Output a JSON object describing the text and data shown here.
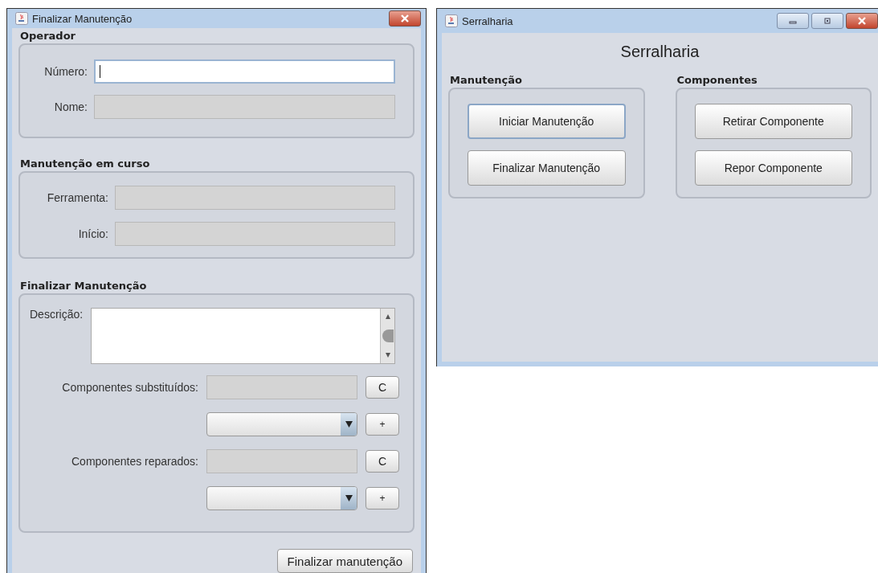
{
  "dialog": {
    "title": "Finalizar Manutenção",
    "operador": {
      "title": "Operador",
      "fields": [
        {
          "label": "Número:",
          "editable": true,
          "focused": true
        },
        {
          "label": "Nome:",
          "editable": false,
          "focused": false
        }
      ]
    },
    "em_curso": {
      "title": "Manutenção em curso",
      "fields": [
        {
          "label": "Ferramenta:",
          "editable": false,
          "focused": false
        },
        {
          "label": "Início:",
          "editable": false,
          "focused": false
        }
      ]
    },
    "finalizar": {
      "title": "Finalizar Manutenção",
      "description_label": "Descrição:",
      "components": [
        {
          "label": "Componentes substituídos:",
          "clear_button": "C",
          "add_button": "+"
        },
        {
          "label": "Componentes reparados:",
          "clear_button": "C",
          "add_button": "+"
        }
      ]
    },
    "submit_button": "Finalizar manutenção"
  },
  "main_window": {
    "title": "Serralharia",
    "heading": "Serralharia",
    "groups": [
      {
        "title": "Manutenção",
        "buttons": [
          {
            "label": "Iniciar Manutenção",
            "focused": true
          },
          {
            "label": "Finalizar Manutenção",
            "focused": false
          }
        ]
      },
      {
        "title": "Componentes",
        "buttons": [
          {
            "label": "Retirar Componente",
            "focused": false
          },
          {
            "label": "Repor Componente",
            "focused": false
          }
        ]
      }
    ]
  }
}
